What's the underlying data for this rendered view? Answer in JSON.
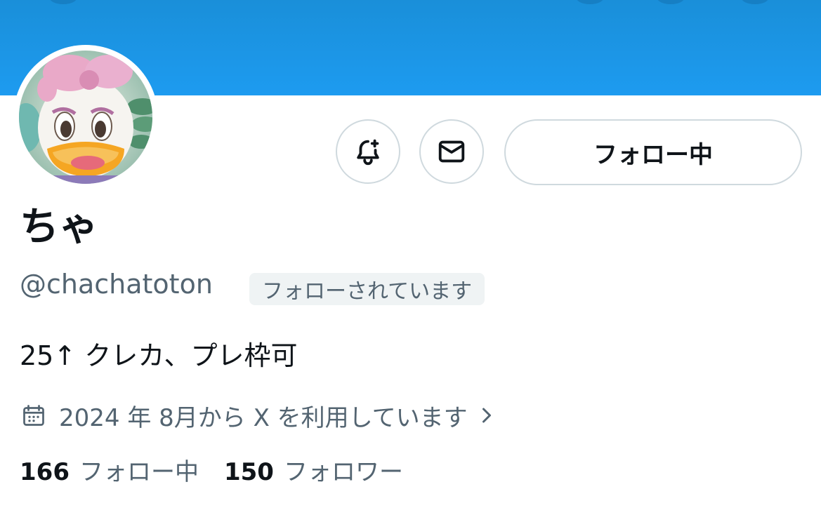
{
  "profile": {
    "display_name": "ちゃ",
    "handle": "@chachatoton",
    "follows_you_badge": "フォローされています",
    "bio": "25↑ クレカ、プレ枠可",
    "joined": "2024 年 8月から X を利用しています",
    "following_count": "166",
    "following_label": "フォロー中",
    "followers_count": "150",
    "followers_label": "フォロワー"
  },
  "actions": {
    "notify_icon": "bell-plus-icon",
    "message_icon": "envelope-icon",
    "follow_button_label": "フォロー中"
  },
  "icons": {
    "calendar": "calendar-icon",
    "chevron": "chevron-right-icon"
  },
  "colors": {
    "banner": "#1d9bf0",
    "primary_text": "#0f1419",
    "secondary_text": "#536471",
    "border": "#cfd9de",
    "badge_bg": "#eff3f4"
  }
}
